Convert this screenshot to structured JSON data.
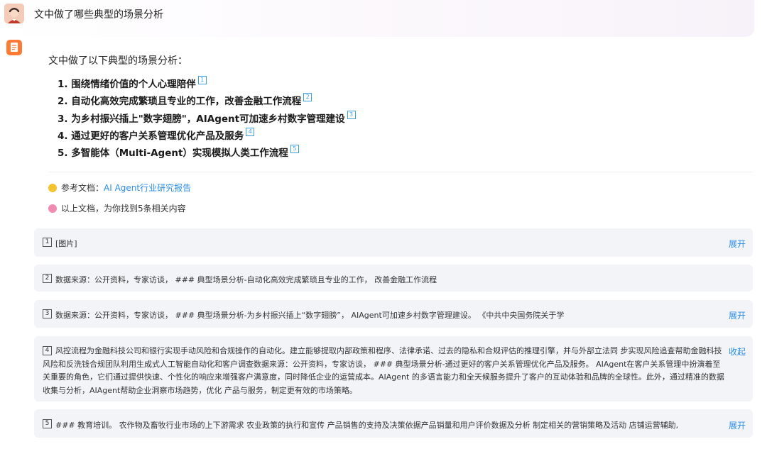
{
  "question": "文中做了哪些典型的场景分析",
  "answer": {
    "intro": "文中做了以下典型的场景分析：",
    "points": [
      {
        "text": "1. 围绕情绪价值的个人心理陪伴",
        "cite": "1"
      },
      {
        "text": "2. 自动化高效完成繁琐且专业的工作，改善金融工作流程",
        "cite": "2"
      },
      {
        "text": "3. 为乡村振兴插上\"数字翅膀\"，AIAgent可加速乡村数字管理建设",
        "cite": "3"
      },
      {
        "text": "4. 通过更好的客户关系管理优化产品及服务",
        "cite": "4"
      },
      {
        "text": "5. 多智能体（Multi-Agent）实现模拟人类工作流程",
        "cite": "5"
      }
    ],
    "ref_label": "参考文档：",
    "ref_doc": "AI Agent行业研究报告",
    "found_text": "以上文档，为你找到5条相关内容"
  },
  "sources": [
    {
      "num": "1",
      "text": "[图片]",
      "toggle": "展开"
    },
    {
      "num": "2",
      "text": "数据来源：公开资料，专家访谈，                    ### 典型场景分析-自动化高效完成繁琐且专业的工作， 改善金融工作流程",
      "toggle": ""
    },
    {
      "num": "3",
      "text": "数据来源：公开资料，专家访谈，                    ### 典型场景分析-为乡村振兴插上“数字翅膀”， AIAgent可加速乡村数字管理建设。                    《中共中央国务院关于学",
      "toggle": "展开"
    },
    {
      "num": "4",
      "text": "风控流程为金融科技公司和银行实现手动风险和合规操作的自动化。建立能够提取内部政策和程序、法律承诺、过去的隐私和合规评估的推理引擎，并与外部立法同 步实现风险追查帮助金融科技风险和反洗钱合规团队利用生成式人工智能自动化和客户调查数据来源：公开资料，专家访谈，                    ### 典型场景分析-通过更好的客户关系管理优化产品及服务。                    AIAgent在客户关系管理中扮演着至关重要的角色，它们通过提供快速、个性化的响应来增强客户满意度，同时降低企业的运营成本。AIAgent 的多语言能力和全天候服务提升了客户的互动体验和品牌的全球性。此外，通过精准的数据收集与分析，AIAgent帮助企业洞察市场趋势，优化 产品与服务，制定更有效的市场策略。",
      "toggle": "收起"
    },
    {
      "num": "5",
      "text": "### 教育培训。 农作物及畜牧行业市场的上下游需求 农业政策的执行和宣传 产品销售的支持及决策依据产品销量和用户评价数据及分析 制定相关的营销策略及活动 店铺运营辅助,",
      "toggle": "展开"
    }
  ],
  "colors": {
    "accent": "#2c8ee8",
    "doc_icon": "#ff7b35",
    "source_bg": "#f3f4f7"
  }
}
